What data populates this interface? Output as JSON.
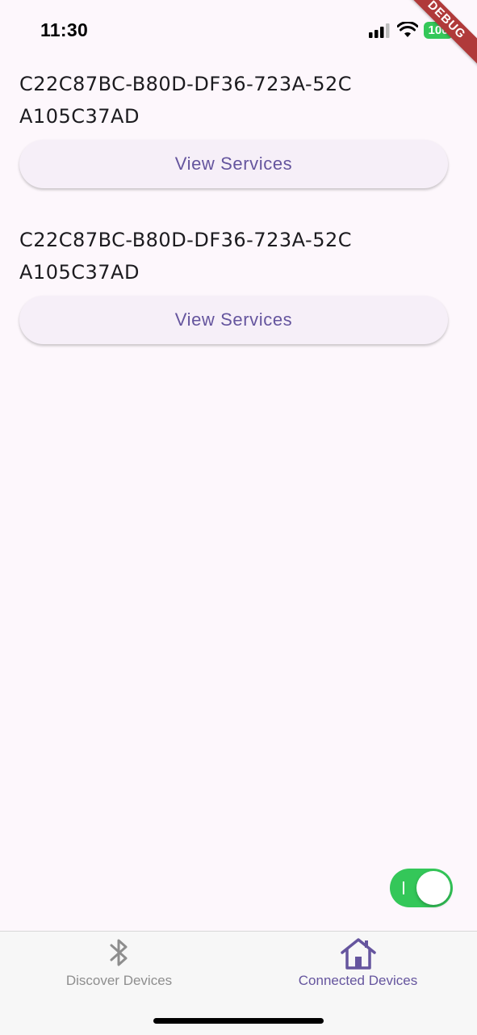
{
  "status_bar": {
    "time": "11:30",
    "battery": "100",
    "debug_banner": "DEBUG"
  },
  "devices": [
    {
      "id": "C22C87BC-B80D-DF36-723A-52CA105C37AD",
      "button_label": "View Services"
    },
    {
      "id": "C22C87BC-B80D-DF36-723A-52CA105C37AD",
      "button_label": "View Services"
    }
  ],
  "toggle": {
    "state": "on",
    "color": "#34c759"
  },
  "bottom_nav": {
    "items": [
      {
        "label": "Discover Devices",
        "icon": "bluetooth-icon",
        "active": false
      },
      {
        "label": "Connected Devices",
        "icon": "home-icon",
        "active": true
      }
    ],
    "active_color": "#65559e",
    "inactive_color": "#8e8e8e"
  }
}
